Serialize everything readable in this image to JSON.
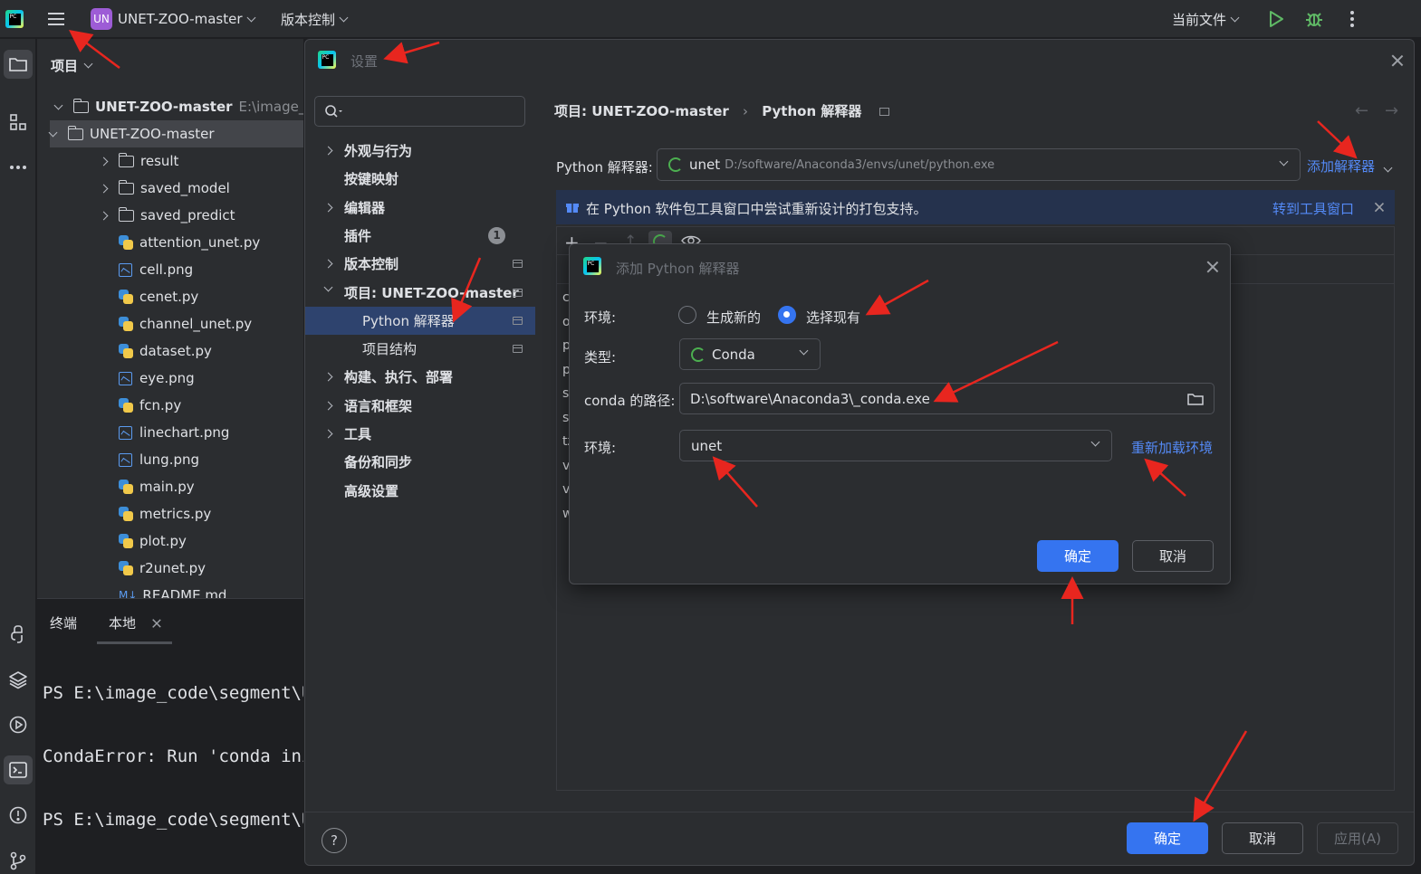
{
  "titlebar": {
    "project_badge": "UN",
    "project_name": "UNET-ZOO-master",
    "vcs": "版本控制",
    "run_config": "当前文件"
  },
  "project_panel": {
    "title": "项目",
    "root_name": "UNET-ZOO-master",
    "root_path": "E:\\image_c",
    "items": [
      {
        "label": "UNET-ZOO-master",
        "kind": "folder"
      },
      {
        "label": "result",
        "kind": "folder"
      },
      {
        "label": "saved_model",
        "kind": "folder"
      },
      {
        "label": "saved_predict",
        "kind": "folder"
      },
      {
        "label": "attention_unet.py",
        "kind": "py"
      },
      {
        "label": "cell.png",
        "kind": "img"
      },
      {
        "label": "cenet.py",
        "kind": "py"
      },
      {
        "label": "channel_unet.py",
        "kind": "py"
      },
      {
        "label": "dataset.py",
        "kind": "py"
      },
      {
        "label": "eye.png",
        "kind": "img"
      },
      {
        "label": "fcn.py",
        "kind": "py"
      },
      {
        "label": "linechart.png",
        "kind": "img"
      },
      {
        "label": "lung.png",
        "kind": "img"
      },
      {
        "label": "main.py",
        "kind": "py"
      },
      {
        "label": "metrics.py",
        "kind": "py"
      },
      {
        "label": "plot.py",
        "kind": "py"
      },
      {
        "label": "r2unet.py",
        "kind": "py"
      },
      {
        "label": "README.md",
        "kind": "md"
      }
    ]
  },
  "terminal": {
    "tab_title": "终端",
    "tab_local": "本地",
    "lines": [
      "PS E:\\image_code\\segment\\U",
      "CondaError: Run 'conda ini",
      "PS E:\\image_code\\segment\\U"
    ]
  },
  "settings": {
    "title": "设置",
    "search_placeholder": "",
    "nav": [
      {
        "label": "外观与行为"
      },
      {
        "label": "按键映射"
      },
      {
        "label": "编辑器"
      },
      {
        "label": "插件",
        "badge": "1"
      },
      {
        "label": "版本控制"
      },
      {
        "label": "项目: UNET-ZOO-master"
      },
      {
        "label": "Python 解释器"
      },
      {
        "label": "项目结构"
      },
      {
        "label": "构建、执行、部署"
      },
      {
        "label": "语言和框架"
      },
      {
        "label": "工具"
      },
      {
        "label": "备份和同步"
      },
      {
        "label": "高级设置"
      }
    ],
    "breadcrumb_project": "项目: UNET-ZOO-master",
    "breadcrumb_page": "Python 解释器",
    "interpreter_label": "Python 解释器:",
    "interpreter_name": "unet",
    "interpreter_path": "D:/software/Anaconda3/envs/unet/python.exe",
    "add_interpreter": "添加解释器",
    "banner_text": "在 Python 软件包工具窗口中尝试重新设计的打包支持。",
    "banner_link": "转到工具窗口",
    "package_stubs": [
      "ca",
      "o",
      "p",
      "p",
      "se",
      "so",
      "tz",
      "ve",
      "vs",
      "w"
    ],
    "ok": "确定",
    "cancel": "取消",
    "apply": "应用(A)"
  },
  "add_interpreter_dialog": {
    "title": "添加 Python 解释器",
    "env_label": "环境:",
    "radio_new": "生成新的",
    "radio_existing": "选择现有",
    "type_label": "类型:",
    "type_value": "Conda",
    "conda_path_label": "conda 的路径:",
    "conda_path_value": "D:\\software\\Anaconda3\\_conda.exe",
    "env2_label": "环境:",
    "env_value": "unet",
    "reload": "重新加载环境",
    "ok": "确定",
    "cancel": "取消"
  },
  "colors": {
    "accent": "#3574f0",
    "annotation_arrow": "#e8261f",
    "selection": "#2e436e"
  }
}
